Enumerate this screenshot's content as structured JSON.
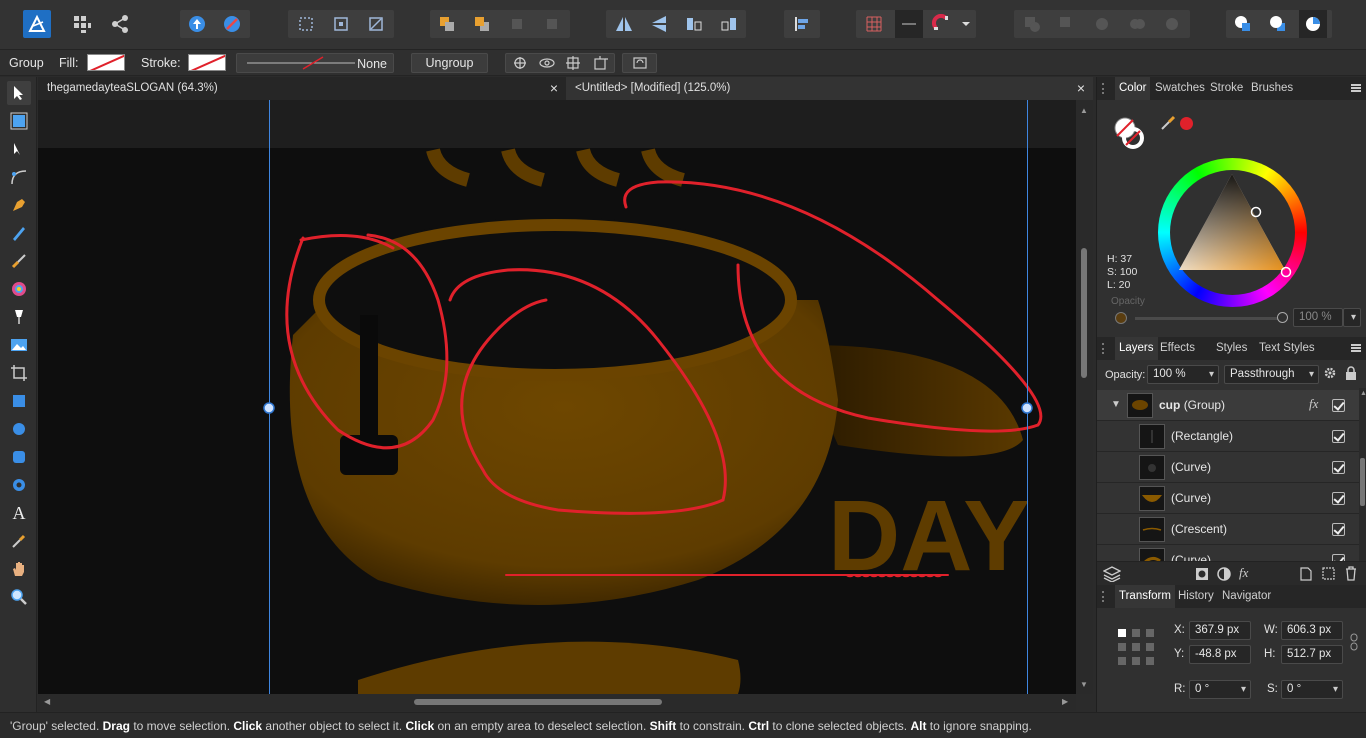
{
  "context_bar": {
    "object_type": "Group",
    "fill_label": "Fill:",
    "stroke_label": "Stroke:",
    "stroke_style_value": "None",
    "ungroup_label": "Ungroup"
  },
  "document_tabs": [
    {
      "label": "thegamedayteaSLOGAN (64.3%)",
      "close": "×"
    },
    {
      "label": "<Untitled> [Modified] (125.0%)",
      "close": "×"
    }
  ],
  "canvas": {
    "artwork_text": "DAY",
    "accent_color": "#e0212b",
    "cup_color": "#6b4400",
    "selection_color": "#3f86e0"
  },
  "color_panel": {
    "tabs": [
      "Color",
      "Swatches",
      "Stroke",
      "Brushes"
    ],
    "h_label": "H: 37",
    "s_label": "S: 100",
    "l_label": "L: 20",
    "opacity_label": "Opacity",
    "opacity_value": "100 %"
  },
  "layers_panel": {
    "tabs": [
      "Layers",
      "Effects",
      "Styles",
      "Text Styles"
    ],
    "opacity_label": "Opacity:",
    "opacity_value": "100 %",
    "blend_mode": "Passthrough",
    "group_name": "cup",
    "group_type": "(Group)",
    "fx_label": "fx",
    "children": [
      {
        "name": "(Rectangle)"
      },
      {
        "name": "(Curve)"
      },
      {
        "name": "(Curve)"
      },
      {
        "name": "(Crescent)"
      },
      {
        "name": "(Curve)"
      }
    ]
  },
  "transform_panel": {
    "tabs": [
      "Transform",
      "History",
      "Navigator"
    ],
    "x_label": "X:",
    "x_value": "367.9 px",
    "w_label": "W:",
    "w_value": "606.3 px",
    "y_label": "Y:",
    "y_value": "-48.8 px",
    "h_label": "H:",
    "h_value": "512.7 px",
    "r_label": "R:",
    "r_value": "0 °",
    "s_label": "S:",
    "s_value": "0 °"
  },
  "status": {
    "p1": "'Group' selected. ",
    "b1": "Drag",
    "p2": " to move selection. ",
    "b2": "Click",
    "p3": " another object to select it. ",
    "b3": "Click",
    "p4": " on an empty area to deselect selection. ",
    "b4": "Shift",
    "p5": " to constrain. ",
    "b5": "Ctrl",
    "p6": " to clone selected objects. ",
    "b6": "Alt",
    "p7": " to ignore snapping."
  }
}
